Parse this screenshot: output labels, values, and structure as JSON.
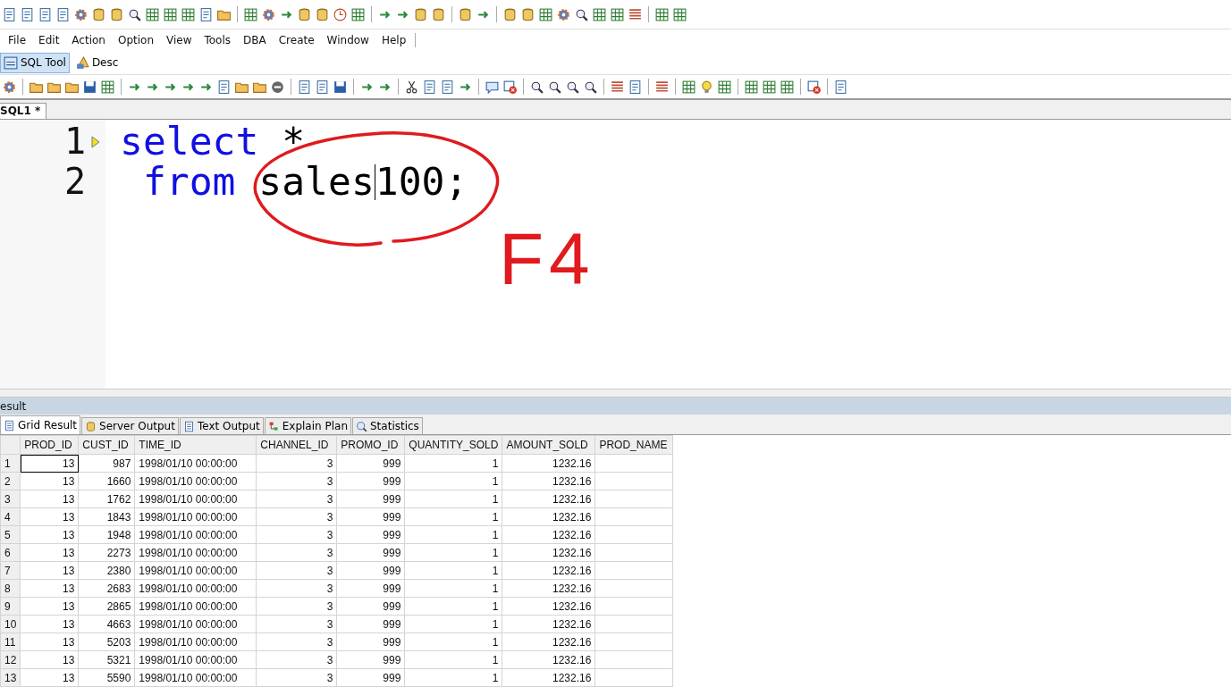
{
  "menu": [
    "File",
    "Edit",
    "Action",
    "Option",
    "View",
    "Tools",
    "DBA",
    "Create",
    "Window",
    "Help"
  ],
  "tool_tabs": [
    {
      "label": "SQL Tool",
      "selected": true
    },
    {
      "label": "Desc",
      "selected": false
    }
  ],
  "editor_tab": {
    "label": "SQL1 *"
  },
  "editor": {
    "lines": [
      {
        "number": "1",
        "current": true,
        "tokens": [
          {
            "text": "select",
            "kind": "keyword",
            "caret": false
          },
          {
            "text": " *",
            "kind": "plain",
            "caret": false
          }
        ]
      },
      {
        "number": "2",
        "current": false,
        "tokens": [
          {
            "text": " from",
            "kind": "keyword",
            "caret": false
          },
          {
            "text": " sales",
            "kind": "plain",
            "caret": true
          },
          {
            "text": "100;",
            "kind": "plain",
            "caret": false
          }
        ]
      }
    ]
  },
  "annotation": {
    "text": "F4"
  },
  "result": {
    "title": "esult",
    "tabs": [
      {
        "label": "Grid Result",
        "selected": true
      },
      {
        "label": "Server Output",
        "selected": false
      },
      {
        "label": "Text Output",
        "selected": false
      },
      {
        "label": "Explain Plan",
        "selected": false
      },
      {
        "label": "Statistics",
        "selected": false
      }
    ],
    "columns": [
      {
        "label": "PROD_ID",
        "kind": "number"
      },
      {
        "label": "CUST_ID",
        "kind": "number"
      },
      {
        "label": "TIME_ID",
        "kind": "text"
      },
      {
        "label": "CHANNEL_ID",
        "kind": "number"
      },
      {
        "label": "PROMO_ID",
        "kind": "number"
      },
      {
        "label": "QUANTITY_SOLD",
        "kind": "number"
      },
      {
        "label": "AMOUNT_SOLD",
        "kind": "number"
      },
      {
        "label": "PROD_NAME"
      }
    ],
    "rows": [
      {
        "number": "1",
        "focused": true,
        "cells": [
          "13",
          "987",
          "1998/01/10 00:00:00",
          "3",
          "999",
          "1",
          "1232.16",
          ""
        ]
      },
      {
        "number": "2",
        "focused": false,
        "cells": [
          "13",
          "1660",
          "1998/01/10 00:00:00",
          "3",
          "999",
          "1",
          "1232.16",
          ""
        ]
      },
      {
        "number": "3",
        "focused": false,
        "cells": [
          "13",
          "1762",
          "1998/01/10 00:00:00",
          "3",
          "999",
          "1",
          "1232.16",
          ""
        ]
      },
      {
        "number": "4",
        "focused": false,
        "cells": [
          "13",
          "1843",
          "1998/01/10 00:00:00",
          "3",
          "999",
          "1",
          "1232.16",
          ""
        ]
      },
      {
        "number": "5",
        "focused": false,
        "cells": [
          "13",
          "1948",
          "1998/01/10 00:00:00",
          "3",
          "999",
          "1",
          "1232.16",
          ""
        ]
      },
      {
        "number": "6",
        "focused": false,
        "cells": [
          "13",
          "2273",
          "1998/01/10 00:00:00",
          "3",
          "999",
          "1",
          "1232.16",
          ""
        ]
      },
      {
        "number": "7",
        "focused": false,
        "cells": [
          "13",
          "2380",
          "1998/01/10 00:00:00",
          "3",
          "999",
          "1",
          "1232.16",
          ""
        ]
      },
      {
        "number": "8",
        "focused": false,
        "cells": [
          "13",
          "2683",
          "1998/01/10 00:00:00",
          "3",
          "999",
          "1",
          "1232.16",
          ""
        ]
      },
      {
        "number": "9",
        "focused": false,
        "cells": [
          "13",
          "2865",
          "1998/01/10 00:00:00",
          "3",
          "999",
          "1",
          "1232.16",
          ""
        ]
      },
      {
        "number": "10",
        "focused": false,
        "cells": [
          "13",
          "4663",
          "1998/01/10 00:00:00",
          "3",
          "999",
          "1",
          "1232.16",
          ""
        ]
      },
      {
        "number": "11",
        "focused": false,
        "cells": [
          "13",
          "5203",
          "1998/01/10 00:00:00",
          "3",
          "999",
          "1",
          "1232.16",
          ""
        ]
      },
      {
        "number": "12",
        "focused": false,
        "cells": [
          "13",
          "5321",
          "1998/01/10 00:00:00",
          "3",
          "999",
          "1",
          "1232.16",
          ""
        ]
      },
      {
        "number": "13",
        "focused": false,
        "cells": [
          "13",
          "5590",
          "1998/01/10 00:00:00",
          "3",
          "999",
          "1",
          "1232.16",
          ""
        ]
      }
    ]
  }
}
